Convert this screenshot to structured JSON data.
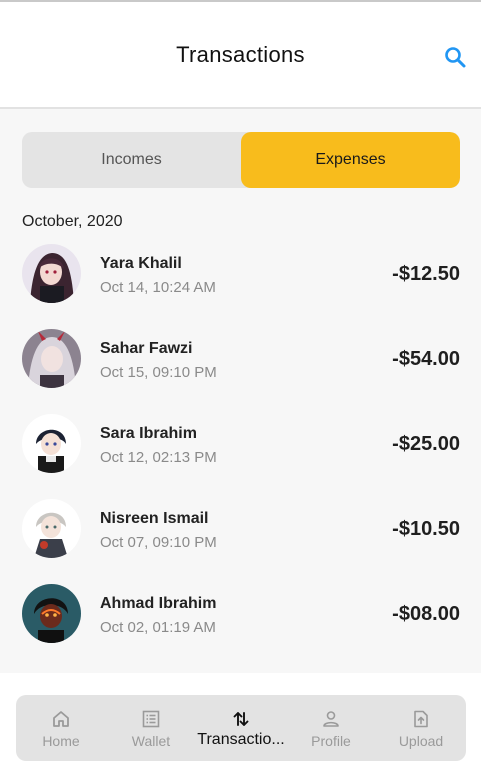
{
  "header": {
    "title": "Transactions",
    "search_icon": "search-icon"
  },
  "tabs": [
    {
      "label": "Incomes",
      "active": false
    },
    {
      "label": "Expenses",
      "active": true
    }
  ],
  "colors": {
    "accent": "#f8bc1c",
    "search": "#2196f3"
  },
  "month_label": "October, 2020",
  "transactions": [
    {
      "name": "Yara Khalil",
      "datetime": "Oct 14, 10:24 AM",
      "amount": "-$12.50"
    },
    {
      "name": "Sahar Fawzi",
      "datetime": "Oct 15, 09:10 PM",
      "amount": "-$54.00"
    },
    {
      "name": "Sara Ibrahim",
      "datetime": "Oct 12, 02:13 PM",
      "amount": "-$25.00"
    },
    {
      "name": "Nisreen Ismail",
      "datetime": "Oct 07, 09:10 PM",
      "amount": "-$10.50"
    },
    {
      "name": "Ahmad Ibrahim",
      "datetime": "Oct 02, 01:19 AM",
      "amount": "-$08.00"
    }
  ],
  "nav": [
    {
      "label": "Home",
      "icon": "home-icon",
      "active": false
    },
    {
      "label": "Wallet",
      "icon": "wallet-icon",
      "active": false
    },
    {
      "label": "Transactio...",
      "icon": "transfer-arrows-icon",
      "active": true
    },
    {
      "label": "Profile",
      "icon": "person-icon",
      "active": false
    },
    {
      "label": "Upload",
      "icon": "upload-file-icon",
      "active": false
    }
  ]
}
